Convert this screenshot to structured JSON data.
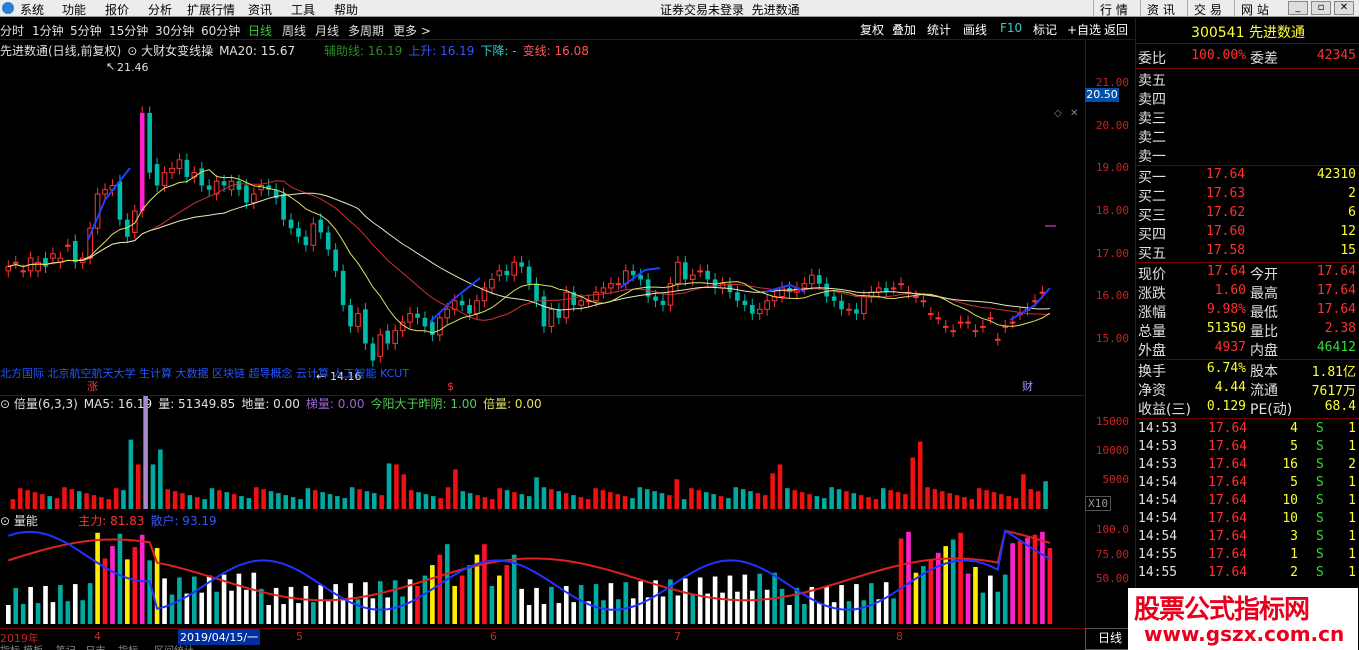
{
  "menu": {
    "items": [
      "系统",
      "功能",
      "报价",
      "分析",
      "扩展行情",
      "资讯",
      "工具",
      "帮助"
    ],
    "status": "证券交易未登录",
    "app": "先进数通",
    "nav": [
      "行 情",
      "资 讯",
      "交 易",
      "网 站"
    ]
  },
  "periods": [
    "分时",
    "1分钟",
    "5分钟",
    "15分钟",
    "30分钟",
    "60分钟",
    "日线",
    "周线",
    "月线",
    "多周期",
    "更多 >"
  ],
  "tools": [
    "复权",
    "叠加",
    "统计",
    "画线",
    "F10",
    "标记",
    "+自选",
    "返回"
  ],
  "legend1": {
    "title": "先进数通(日线,前复权)",
    "indicator": "大财女变线操",
    "ma20": "MA20: 15.67",
    "aux": "辅助线: 16.19",
    "up": "上升: 16.19",
    "down": "下降: -",
    "change": "变线: 16.08"
  },
  "annot": {
    "high": "21.46",
    "low": "14.16",
    "scroll": "北方国际 北京航空航天大学 生计算 大数据 区块链 超导概念 云计算 人工智能 KCUT",
    "zhang": "涨",
    "sm": "$",
    "cai": "财"
  },
  "legend2": {
    "name": "倍量(6,3,3)",
    "ma5": "MA5: 16.19",
    "vol": "量: 51349.85",
    "ground": "地量: 0.00",
    "ladder": "梯量: 0.00",
    "yang": "今阳大于昨阴: 1.00",
    "bei": "倍量: 0.00"
  },
  "legend3": {
    "name": "量能",
    "main": "主力: 81.83",
    "retail": "散户: 93.19"
  },
  "price_axis": [
    "21.00",
    "20.00",
    "19.00",
    "18.00",
    "17.00",
    "16.00",
    "15.00"
  ],
  "current_price_tag": "20.50",
  "vol_axis": [
    "15000",
    "10000",
    "5000"
  ],
  "vol_unit": "X10",
  "energy_axis": [
    "100.0",
    "75.00",
    "50.00"
  ],
  "dates": {
    "year": "2019年",
    "m4": "4",
    "box": "2019/04/15/一",
    "m5": "5",
    "m6": "6",
    "m7": "7",
    "m8": "8"
  },
  "bottom_tabs": "指标 模板    笔记   日志    指标     区间统计",
  "daytab": "日线",
  "stock": {
    "code": "300541",
    "name": "先进数通"
  },
  "weibi": {
    "label": "委比",
    "value": "100.00%",
    "label2": "委差",
    "value2": "42345"
  },
  "sells": [
    {
      "label": "卖五"
    },
    {
      "label": "卖四"
    },
    {
      "label": "卖三"
    },
    {
      "label": "卖二"
    },
    {
      "label": "卖一"
    }
  ],
  "buys": [
    {
      "label": "买一",
      "price": "17.64",
      "qty": "42310"
    },
    {
      "label": "买二",
      "price": "17.63",
      "qty": "2"
    },
    {
      "label": "买三",
      "price": "17.62",
      "qty": "6"
    },
    {
      "label": "买四",
      "price": "17.60",
      "qty": "12"
    },
    {
      "label": "买五",
      "price": "17.58",
      "qty": "15"
    }
  ],
  "quote": [
    {
      "l1": "现价",
      "v1": "17.64",
      "l2": "今开",
      "v2": "17.64"
    },
    {
      "l1": "涨跌",
      "v1": "1.60",
      "l2": "最高",
      "v2": "17.64"
    },
    {
      "l1": "涨幅",
      "v1": "9.98%",
      "l2": "最低",
      "v2": "17.64"
    },
    {
      "l1": "总量",
      "v1": "51350",
      "l2": "量比",
      "v2": "2.38"
    },
    {
      "l1": "外盘",
      "v1": "4937",
      "l2": "内盘",
      "v2": "46412"
    }
  ],
  "fund": [
    {
      "l1": "换手",
      "v1": "6.74%",
      "l2": "股本",
      "v2": "1.81亿"
    },
    {
      "l1": "净资",
      "v1": "4.44",
      "l2": "流通",
      "v2": "7617万"
    },
    {
      "l1": "收益(三)",
      "v1": "0.129",
      "l2": "PE(动)",
      "v2": "68.4"
    }
  ],
  "ticks": [
    {
      "t": "14:53",
      "p": "17.64",
      "q": "4",
      "s": "S",
      "n": "1"
    },
    {
      "t": "14:53",
      "p": "17.64",
      "q": "5",
      "s": "S",
      "n": "1"
    },
    {
      "t": "14:53",
      "p": "17.64",
      "q": "16",
      "s": "S",
      "n": "2"
    },
    {
      "t": "14:54",
      "p": "17.64",
      "q": "5",
      "s": "S",
      "n": "1"
    },
    {
      "t": "14:54",
      "p": "17.64",
      "q": "10",
      "s": "S",
      "n": "1"
    },
    {
      "t": "14:54",
      "p": "17.64",
      "q": "10",
      "s": "S",
      "n": "1"
    },
    {
      "t": "14:54",
      "p": "17.64",
      "q": "3",
      "s": "S",
      "n": "1"
    },
    {
      "t": "14:55",
      "p": "17.64",
      "q": "1",
      "s": "S",
      "n": "1"
    },
    {
      "t": "14:55",
      "p": "17.64",
      "q": "2",
      "s": "S",
      "n": "1"
    }
  ],
  "watermark": {
    "cn": "股票公式指标网",
    "url": "www.gszx.com.cn"
  },
  "chart_data": [
    {
      "type": "candlestick",
      "title": "先进数通(日线,前复权)",
      "ylim": [
        14.5,
        21.5
      ],
      "close": [
        16.7,
        16.8,
        16.6,
        16.9,
        16.8,
        16.7,
        17.0,
        16.9,
        17.2,
        16.8,
        16.9,
        17.6,
        18.4,
        18.5,
        18.6,
        17.8,
        17.4,
        18.0,
        20.3,
        18.9,
        18.6,
        18.9,
        19.0,
        19.2,
        18.8,
        18.9,
        18.6,
        18.5,
        18.7,
        18.6,
        18.7,
        18.5,
        18.2,
        18.4,
        18.6,
        18.5,
        18.3,
        17.8,
        17.6,
        17.4,
        17.2,
        17.7,
        17.5,
        17.1,
        16.6,
        15.8,
        15.3,
        15.6,
        14.9,
        14.5,
        15.1,
        14.9,
        15.2,
        15.4,
        15.6,
        15.5,
        15.3,
        15.1,
        15.5,
        15.7,
        15.9,
        15.8,
        15.6,
        15.9,
        16.2,
        16.4,
        16.6,
        16.5,
        16.8,
        16.7,
        16.3,
        15.9,
        15.3,
        15.7,
        15.5,
        16.1,
        15.8,
        15.9,
        15.9,
        16.1,
        16.2,
        16.3,
        16.3,
        16.6,
        16.5,
        16.4,
        16.0,
        15.9,
        15.8,
        16.3,
        16.8,
        16.4,
        16.5,
        16.6,
        16.4,
        16.2,
        16.3,
        16.1,
        15.9,
        15.8,
        15.6,
        15.7,
        15.9,
        16.0,
        16.2,
        16.1,
        16.2,
        16.3,
        16.5,
        16.3,
        16.0,
        15.9,
        15.7,
        15.7,
        15.6,
        16.0,
        16.1,
        16.2,
        16.1,
        16.2,
        16.3,
        16.1,
        16.0,
        15.9,
        15.6,
        15.5,
        15.3,
        15.2,
        15.4,
        15.4,
        15.2,
        15.3,
        15.5,
        15.0,
        15.3,
        15.4,
        15.6,
        15.7,
        15.9,
        16.1,
        16.3
      ],
      "open": [
        16.6,
        16.8,
        16.6,
        16.6,
        16.6,
        16.9,
        16.9,
        16.8,
        17.2,
        17.3,
        16.8,
        16.9,
        17.6,
        18.4,
        18.5,
        18.7,
        17.8,
        17.5,
        18.0,
        20.3,
        19.1,
        18.6,
        18.9,
        19.0,
        19.2,
        18.8,
        19.0,
        18.6,
        18.4,
        18.7,
        18.5,
        18.7,
        18.6,
        18.2,
        18.5,
        18.6,
        18.5,
        18.4,
        17.8,
        17.6,
        17.4,
        17.2,
        17.8,
        17.5,
        17.1,
        16.6,
        15.8,
        15.3,
        15.7,
        14.9,
        14.6,
        15.2,
        14.9,
        15.2,
        15.4,
        15.6,
        15.5,
        15.4,
        15.1,
        15.5,
        15.7,
        15.9,
        15.8,
        15.6,
        15.9,
        16.2,
        16.5,
        16.6,
        16.5,
        16.8,
        16.7,
        16.3,
        16.0,
        15.3,
        15.7,
        15.5,
        16.1,
        15.8,
        15.9,
        15.9,
        16.1,
        16.2,
        16.3,
        16.3,
        16.6,
        16.5,
        16.4,
        16.0,
        15.9,
        15.8,
        16.3,
        16.8,
        16.4,
        16.6,
        16.6,
        16.4,
        16.2,
        16.3,
        16.1,
        15.9,
        15.8,
        15.6,
        15.7,
        15.9,
        16.0,
        16.2,
        16.1,
        16.2,
        16.3,
        16.5,
        16.3,
        16.0,
        15.9,
        15.7,
        15.7,
        15.6,
        16.0,
        16.1,
        16.2,
        16.2,
        16.3,
        16.1,
        16.0,
        15.9,
        15.6,
        15.5,
        15.3,
        15.2,
        15.4,
        15.4,
        15.2,
        15.3,
        15.5,
        15.0,
        15.3,
        15.4,
        15.6,
        15.7,
        15.9,
        16.1
      ]
    }
  ]
}
